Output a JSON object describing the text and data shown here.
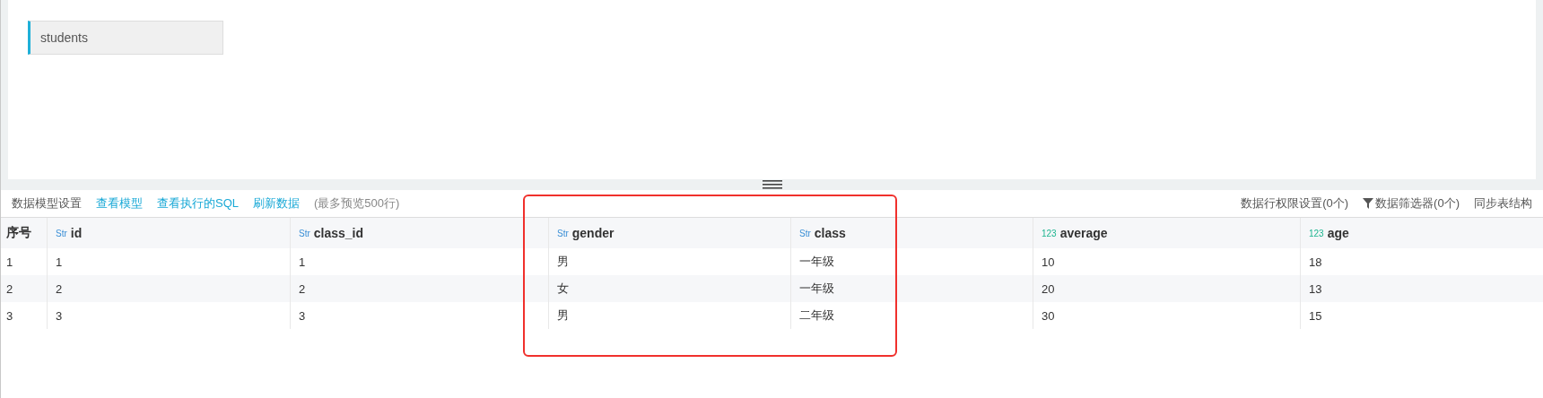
{
  "canvas": {
    "nodes": [
      {
        "label": "students",
        "selected": true
      }
    ]
  },
  "toolbar": {
    "left": [
      {
        "label": "数据模型设置",
        "kind": "plain"
      },
      {
        "label": "查看模型",
        "kind": "link"
      },
      {
        "label": "查看执行的SQL",
        "kind": "link"
      },
      {
        "label": "刷新数据",
        "kind": "link"
      },
      {
        "label": "(最多预览500行)",
        "kind": "note"
      }
    ],
    "right": [
      {
        "label": "数据行权限设置(0个)",
        "kind": "plain"
      },
      {
        "label": "数据筛选器(0个)",
        "kind": "filter"
      },
      {
        "label": "同步表结构",
        "kind": "plain"
      }
    ]
  },
  "table": {
    "columns": [
      {
        "name": "序号",
        "kind": "index"
      },
      {
        "name": "id",
        "kind": "str",
        "type_label": "Str"
      },
      {
        "name": "class_id",
        "kind": "str",
        "type_label": "Str"
      },
      {
        "name": "gender",
        "kind": "str",
        "type_label": "Str"
      },
      {
        "name": "class",
        "kind": "str",
        "type_label": "Str"
      },
      {
        "name": "average",
        "kind": "num",
        "type_label": "123"
      },
      {
        "name": "age",
        "kind": "num",
        "type_label": "123"
      }
    ],
    "rows": [
      [
        "1",
        "1",
        "1",
        "男",
        "一年级",
        "10",
        "18"
      ],
      [
        "2",
        "2",
        "2",
        "女",
        "一年级",
        "20",
        "13"
      ],
      [
        "3",
        "3",
        "3",
        "男",
        "二年级",
        "30",
        "15"
      ]
    ]
  }
}
